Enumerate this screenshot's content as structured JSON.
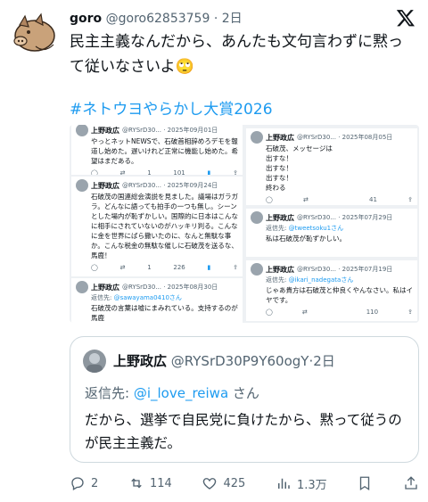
{
  "post": {
    "display_name": "goro",
    "handle": "@goro62853759",
    "sep": "·",
    "time": "2日",
    "text": "民主主義なんだから、あんたも文句言わずに黙って従いなさいよ🙄",
    "hashtag": "#ネトウヨやらかし大賞2026"
  },
  "collage": {
    "cards": [
      {
        "name": "上野政広",
        "meta": "@RYSrD30... · 2025年09月01日",
        "text": "やっとネットNEWSで、石破首相辞めろデモを報道し始めた。遅いけれど正常に機能し始めた。希望はまだある。",
        "reply": "",
        "mention": "",
        "stats": [
          "",
          "",
          "1",
          "101",
          ""
        ]
      },
      {
        "name": "上野政広",
        "meta": "@RYSrD30... · 2025年09月24日",
        "text": "石破茂の国連総会演説を見ました。議場はガラガラ。どんなに語っても拍手の一つも無し。シーンとした場内が恥ずかしい。国際的に日本はこんなに相手にされていないのがハッキリ判る。こんなに金を世界にばら撒いたのに、なんと無駄な事か。こんな税金の無駄な催しに石破茂を送るな、馬鹿！",
        "reply": "",
        "mention": "",
        "stats": [
          "",
          "",
          "1",
          "226",
          ""
        ]
      },
      {
        "name": "上野政広",
        "meta": "@RYSrD30... · 2025年08月30日",
        "text": "石破茂の言葉は嘘にまみれている。支持するのが馬鹿",
        "reply": "返信先: ",
        "mention": "@sawayama0410さん",
        "stats": []
      },
      {
        "name": "上野政広",
        "meta": "@RYSrD30... · 2025年08月05日",
        "text": "石破茂、メッセージは\n出すな！\n出すな！\n出すな！\n終わる",
        "reply": "",
        "mention": "",
        "stats": [
          "",
          "",
          "",
          "41",
          ""
        ]
      },
      {
        "name": "上野政広",
        "meta": "@RYSrD30... · 2025年07月29日",
        "text": "私は石破茂が恥ずかしい。",
        "reply": "返信先: ",
        "mention": "@tweetsoku1さん",
        "stats": []
      },
      {
        "name": "上野政広",
        "meta": "@RYSrD30... · 2025年07月19日",
        "text": "じゃあ貴方は石破茂と仲良くやんなさい。私はイヤです。",
        "reply": "返信先: ",
        "mention": "@ikari_nadegataさん",
        "stats": [
          "",
          "",
          "",
          "110",
          ""
        ]
      }
    ]
  },
  "quote": {
    "display_name": "上野政広",
    "handle": "@RYSrD30P9Y60ogY",
    "sep": "·",
    "time": "2日",
    "reply_prefix": "返信先: ",
    "reply_mention": "@i_love_reiwa",
    "reply_suffix": " さん",
    "text": "だから、選挙で自民党に負けたから、黙って従うのが民主主義だ。"
  },
  "actions": {
    "replies": "2",
    "reposts": "114",
    "likes": "425",
    "views": "1.3万"
  },
  "colors": {
    "accent": "#1d9bf0",
    "muted": "#536471",
    "text": "#0f1419",
    "border": "#cfd9de"
  }
}
